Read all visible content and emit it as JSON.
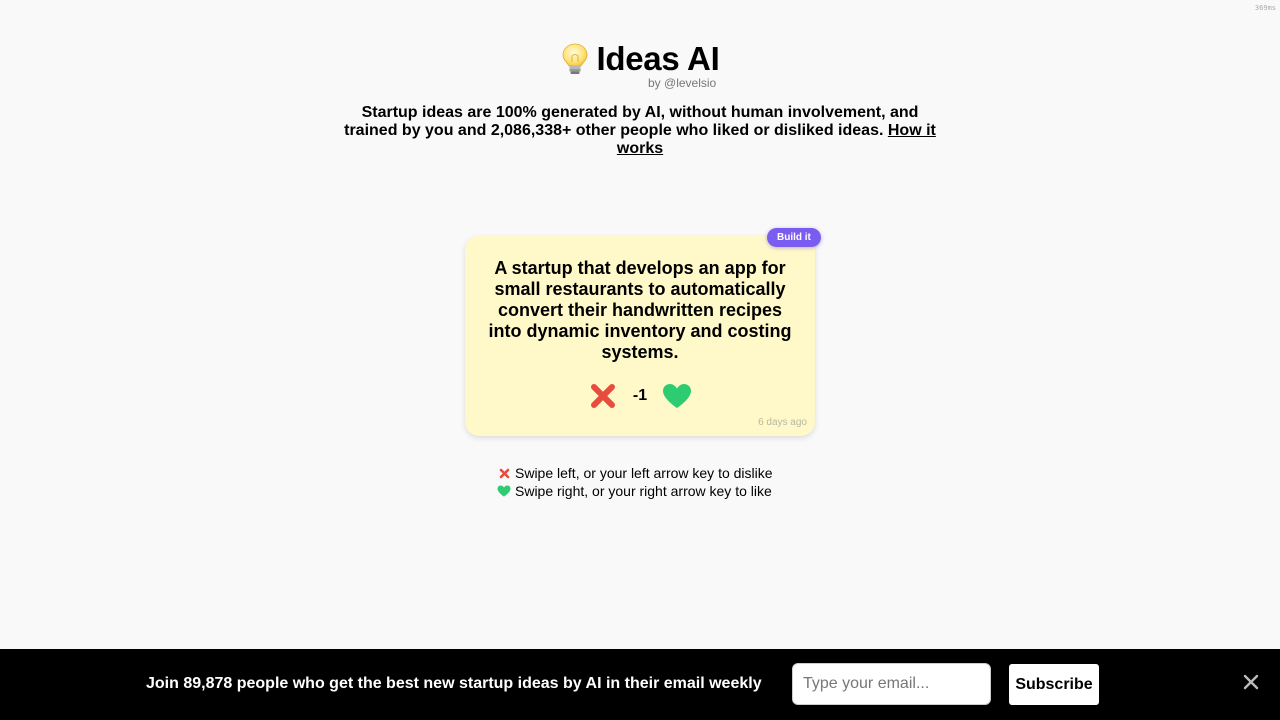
{
  "timing": "369ms",
  "header": {
    "title": "Ideas AI",
    "byline": "by @levelsio",
    "tagline_text": "Startup ideas are 100% generated by AI, without human involvement, and trained by you and 2,086,338+ other people who liked or disliked ideas.",
    "how_it_works": "How it works"
  },
  "card": {
    "badge": "Build it",
    "idea": "A startup that develops an app for small restaurants to automatically convert their handwritten recipes into dynamic inventory and costing systems.",
    "score": "-1",
    "timestamp": "6 days ago",
    "dislike_icon": "x-icon",
    "like_icon": "heart-icon"
  },
  "instructions": {
    "dislike": "Swipe left, or your left arrow key to dislike",
    "like": "Swipe right, or your right arrow key to like"
  },
  "footer": {
    "text": "Join 89,878 people who get the best new startup ideas by AI in their email weekly",
    "email_placeholder": "Type your email...",
    "email_value": "",
    "subscribe": "Subscribe"
  },
  "colors": {
    "accent": "#7b5cf0",
    "card_bg": "#fff9c9",
    "dislike": "#e74c3c",
    "like": "#2ecc71"
  }
}
